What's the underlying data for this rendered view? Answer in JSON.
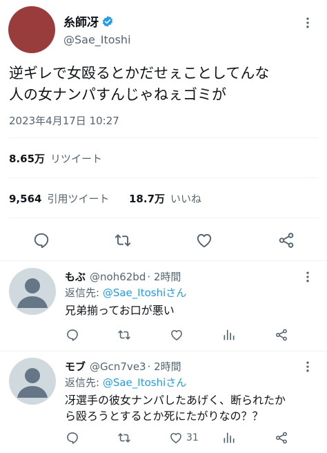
{
  "tweet": {
    "author_name": "糸師冴",
    "author_handle": "@Sae_Itoshi",
    "text_line1": "逆ギレで女殴るとかだせぇことしてんな",
    "text_line2": "人の女ナンパすんじゃねぇゴミが",
    "timestamp": "2023年4月17日 10:27",
    "retweets_count": "8.65万",
    "retweets_label": "リツイート",
    "quotes_count": "9,564",
    "quotes_label": "引用ツイート",
    "likes_count": "18.7万",
    "likes_label": "いいね",
    "avatar_color": "#9b3c3c"
  },
  "replies": [
    {
      "name": "もぶ",
      "handle": "@noh62bd",
      "time": "· 2時間",
      "reply_to_prefix": "返信先: ",
      "reply_to_handle": "@Sae_Itoshiさん",
      "text_line1": "兄弟揃ってお口が悪い",
      "text_line2": "",
      "likes": ""
    },
    {
      "name": "モブ",
      "handle": "@Gcn7ve3",
      "time": "· 2時間",
      "reply_to_prefix": "返信先: ",
      "reply_to_handle": "@Sae_Itoshiさん",
      "text_line1": "冴選手の彼女ナンパしたあげく、断られたか",
      "text_line2": "ら殴ろうとするとか死にたがりなの？？",
      "likes": "31"
    }
  ],
  "colors": {
    "accent": "#1d9bf0",
    "muted": "#536471",
    "border": "#eff3f4"
  }
}
